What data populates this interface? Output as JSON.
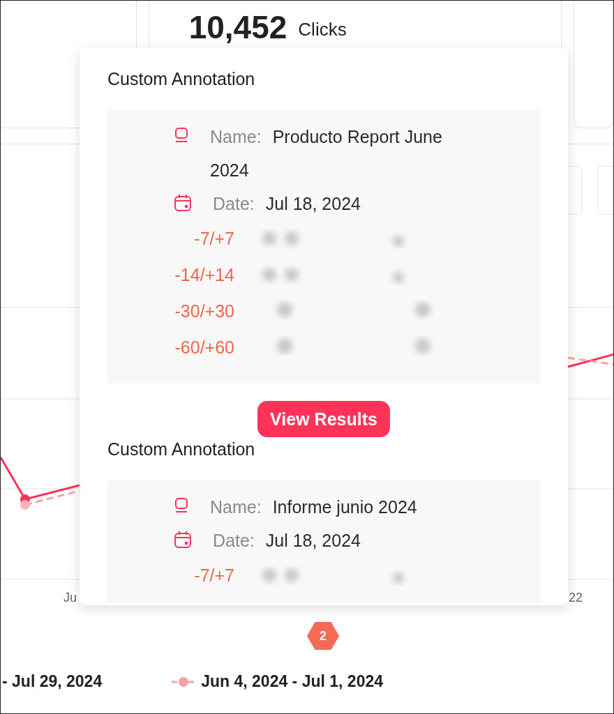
{
  "stat": {
    "value": "10,452",
    "unit": "Clicks"
  },
  "annotations": [
    {
      "title": "Custom Annotation",
      "name_label": "Name:",
      "name": "Producto Report June 2024",
      "date_label": "Date:",
      "date": "Jul 18, 2024",
      "ranges": [
        "-7/+7",
        "-14/+14",
        "-30/+30",
        "-60/+60"
      ],
      "button": "View Results"
    },
    {
      "title": "Custom Annotation",
      "name_label": "Name:",
      "name": "Informe junio 2024",
      "date_label": "Date:",
      "date": "Jul 18, 2024",
      "ranges": [
        "-7/+7"
      ]
    }
  ],
  "x_labels": [
    "Ju",
    "22"
  ],
  "badge": "2",
  "legend": [
    {
      "label": "- Jul 29, 2024",
      "kind": "cut"
    },
    {
      "label": "Jun 4, 2024 - Jul 1, 2024",
      "kind": "dashed"
    }
  ]
}
